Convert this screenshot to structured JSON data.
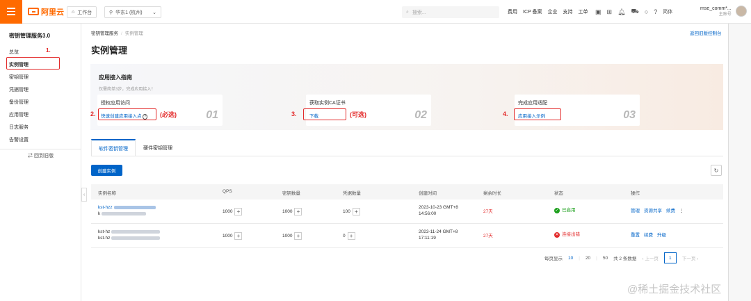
{
  "topbar": {
    "logo_text": "阿里云",
    "workbench": "工作台",
    "region": "华东1 (杭州)",
    "search_placeholder": "搜索...",
    "links": [
      "费用",
      "ICP 备案",
      "企业",
      "支持",
      "工单"
    ],
    "lang": "简体",
    "user_name": "mse_comm*...",
    "user_sub": "主账号"
  },
  "sidebar": {
    "title": "密钥管理服务3.0",
    "items": [
      "总览",
      "实例管理",
      "密钥管理",
      "凭据管理",
      "备份管理",
      "应用管理",
      "日志服务",
      "告警设置"
    ],
    "back": "回到旧版"
  },
  "breadcrumb": {
    "service": "密钥管理服务",
    "current": "实例管理"
  },
  "back_to_old": "返回旧版控制台",
  "page_title": "实例管理",
  "guide": {
    "title": "应用接入指南",
    "subtitle": "仅需简单3步，完成应用接入！",
    "cards": [
      {
        "title": "授权应用访问",
        "link": "快速创建应用接入点",
        "num": "01"
      },
      {
        "title": "获取实例CA证书",
        "link": "下载",
        "num": "02"
      },
      {
        "title": "完成应用适配",
        "link": "应用接入示例",
        "num": "03"
      }
    ]
  },
  "annotations": {
    "n1": "1.",
    "n2": "2.",
    "n3": "3.",
    "n4": "4.",
    "required": "(必选)",
    "optional": "(可选)"
  },
  "tabs": [
    "软件密钥管理",
    "硬件密钥管理"
  ],
  "create_button": "创建实例",
  "refresh_icon": "↻",
  "table": {
    "headers": [
      "实例名称",
      "QPS",
      "密钥数量",
      "凭据数量",
      "创建时间",
      "剩余时长",
      "状态",
      "操作"
    ],
    "rows": [
      {
        "name1": "kst-hzz",
        "name2": "k",
        "qps": "1000",
        "keys": "1000",
        "secrets": "100",
        "created1": "2023-10-23 GMT+8",
        "created2": "14:56:00",
        "remaining": "27天",
        "status": "已启用",
        "ops": [
          "管理",
          "资源共享",
          "续费",
          "⋮"
        ]
      },
      {
        "name1": "kst-hz",
        "name2": "kst-hz",
        "qps": "1000",
        "keys": "1000",
        "secrets": "0",
        "created1": "2023-11-24 GMT+8",
        "created2": "17:11:19",
        "remaining": "27天",
        "status": "连接出错",
        "ops": [
          "重置",
          "续费",
          "升级"
        ]
      }
    ]
  },
  "pagination": {
    "per_page_label": "每页显示",
    "sizes": [
      "10",
      "20",
      "50"
    ],
    "total": "共 2 条数据",
    "prev": "上一页",
    "page": "1",
    "next": "下一页"
  },
  "watermark": "@稀土掘金技术社区",
  "colors": {
    "brand": "#ff6a00",
    "link": "#0064c8",
    "annotation": "#e32b2b",
    "ok": "#1ea01e"
  }
}
